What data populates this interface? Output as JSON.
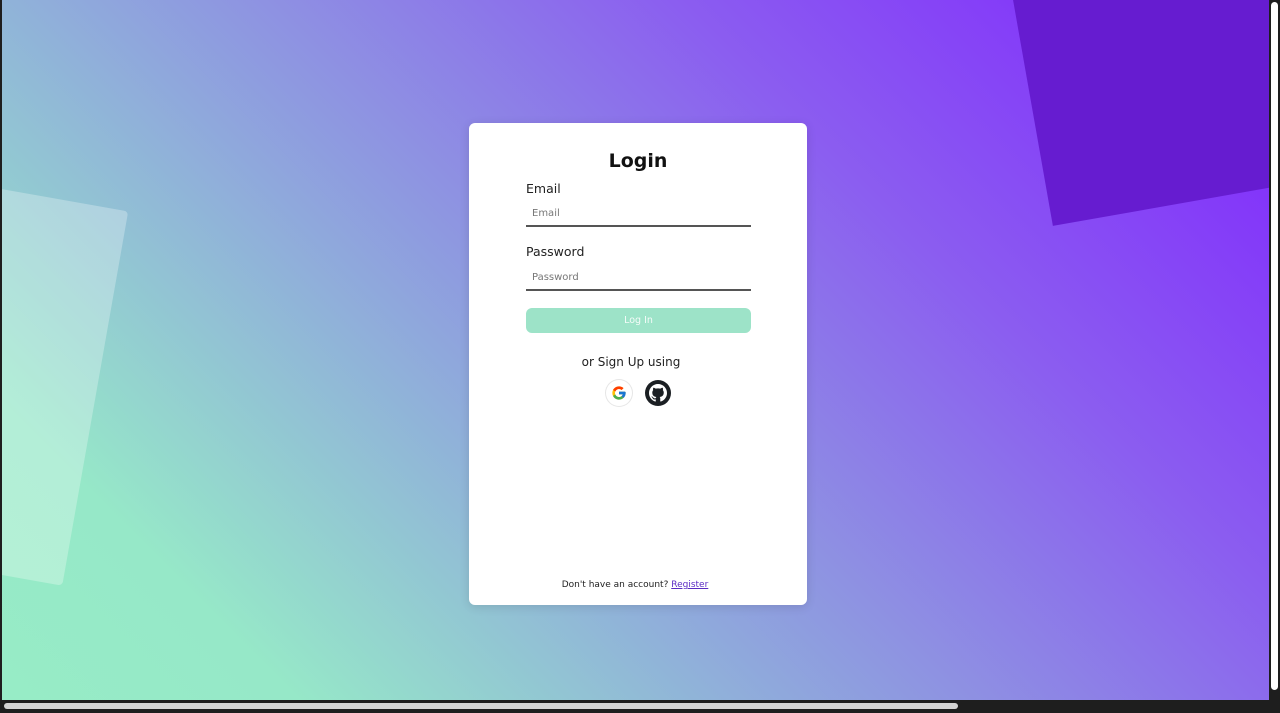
{
  "login": {
    "title": "Login",
    "email_label": "Email",
    "email_placeholder": "Email",
    "email_value": "",
    "password_label": "Password",
    "password_placeholder": "Password",
    "password_value": "",
    "submit_label": "Log In",
    "alt_signup_text": "or Sign Up using",
    "social": [
      {
        "name": "Google",
        "icon": "google-icon"
      },
      {
        "name": "GitHub",
        "icon": "github-icon"
      }
    ],
    "footer_text": "Don't have an account?",
    "register_link": "Register"
  },
  "colors": {
    "button_disabled": "#9de3c8",
    "gradient_start": "#7f22ff",
    "gradient_end": "#97ecc6",
    "accent_shape": "#661cd0",
    "link": "#5b2bc4"
  }
}
